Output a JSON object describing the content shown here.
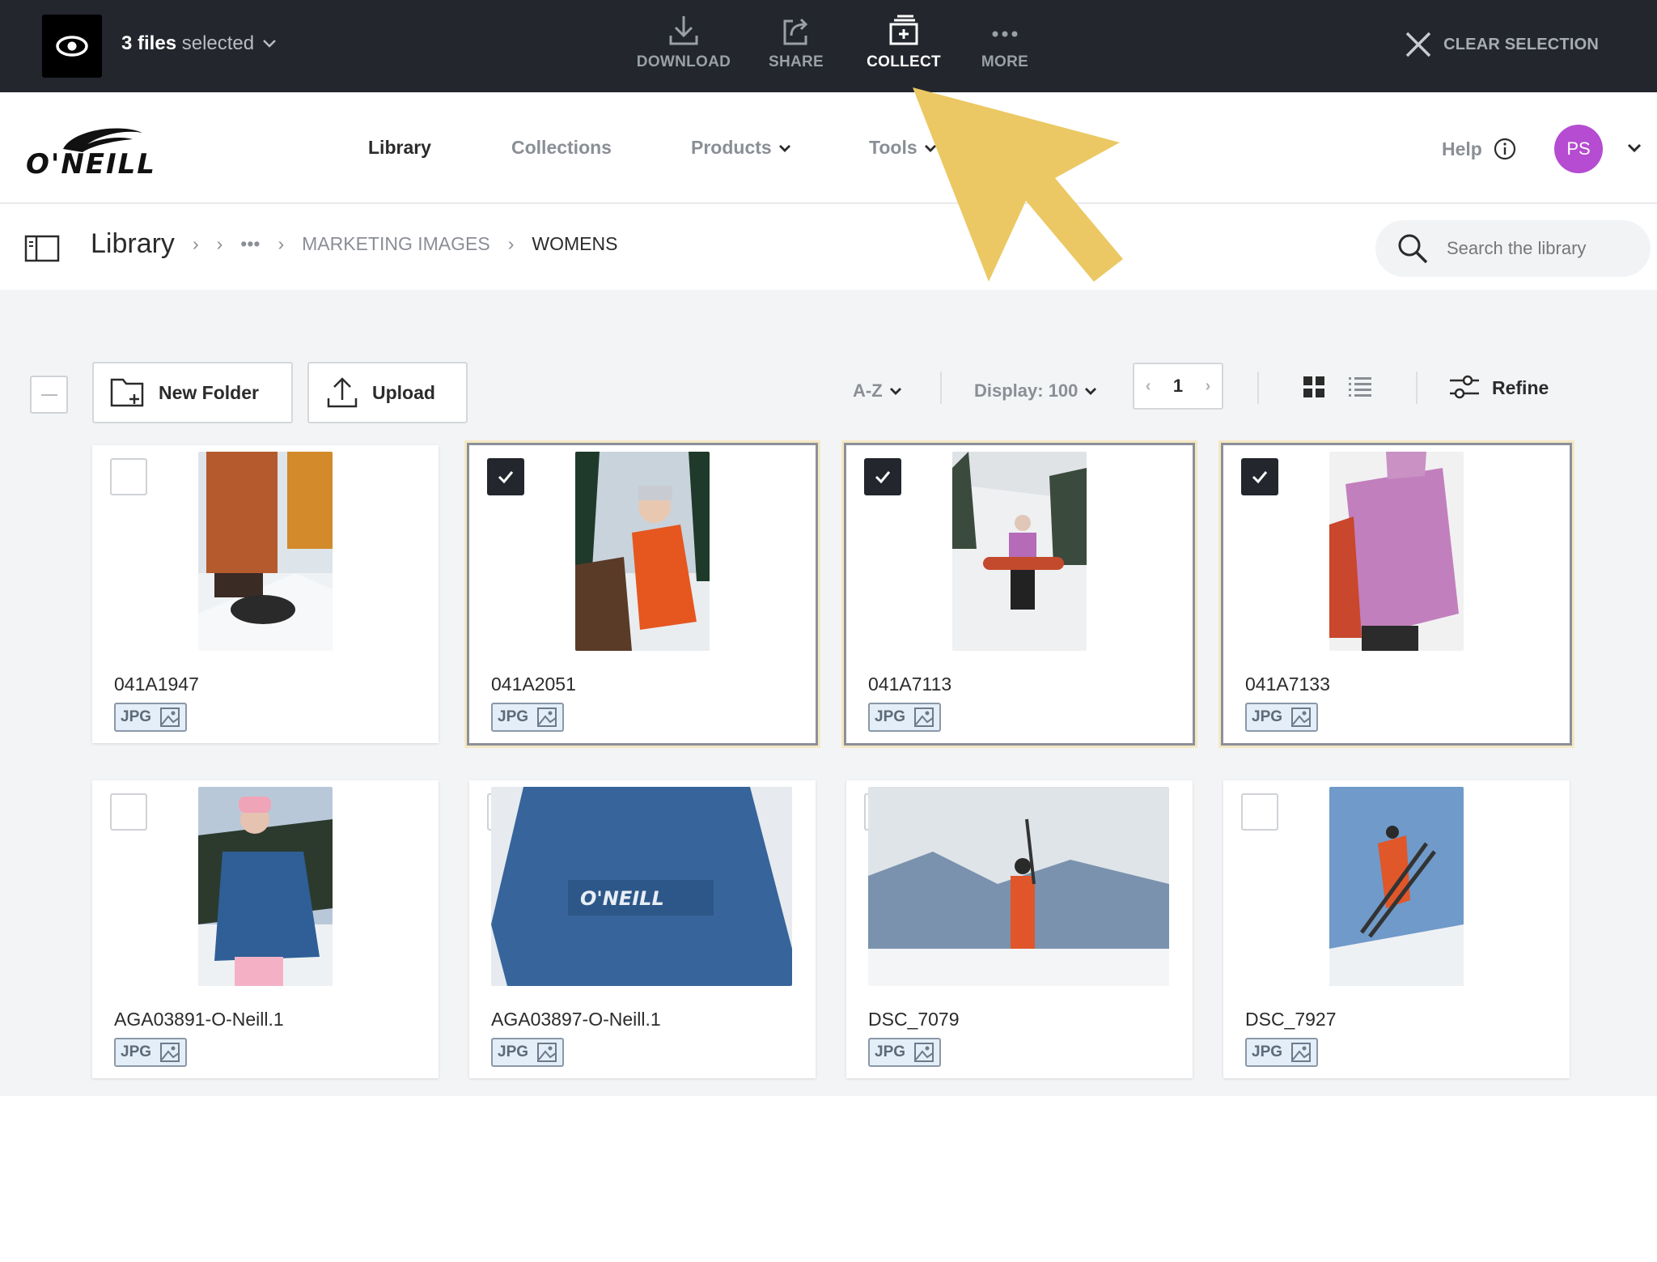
{
  "selection_bar": {
    "count_strong": "3 files",
    "count_rest": "selected",
    "actions": [
      {
        "label": "DOWNLOAD",
        "icon": "download-icon"
      },
      {
        "label": "SHARE",
        "icon": "share-icon"
      },
      {
        "label": "COLLECT",
        "icon": "collect-icon"
      },
      {
        "label": "MORE",
        "icon": "more-icon"
      }
    ],
    "clear_label": "CLEAR SELECTION"
  },
  "nav": {
    "logo_text": "O'NEILL",
    "items": [
      {
        "label": "Library",
        "active": true
      },
      {
        "label": "Collections"
      },
      {
        "label": "Products"
      },
      {
        "label": "Tools"
      }
    ],
    "help_label": "Help",
    "avatar_initials": "PS",
    "avatar_color": "#b54cd1"
  },
  "breadcrumb": {
    "root": "Library",
    "ellipsis": "•••",
    "items": [
      "MARKETING IMAGES",
      "WOMENS"
    ]
  },
  "search": {
    "placeholder": "Search the library"
  },
  "toolbar": {
    "new_folder": "New Folder",
    "upload": "Upload",
    "sort": "A-Z",
    "display": "Display: 100",
    "page": "1",
    "refine": "Refine"
  },
  "files": [
    {
      "name": "041A1947",
      "type": "JPG",
      "selected": false
    },
    {
      "name": "041A2051",
      "type": "JPG",
      "selected": true
    },
    {
      "name": "041A7113",
      "type": "JPG",
      "selected": true
    },
    {
      "name": "041A7133",
      "type": "JPG",
      "selected": true
    },
    {
      "name": "AGA03891-O-Neill.1",
      "type": "JPG",
      "selected": false
    },
    {
      "name": "AGA03897-O-Neill.1",
      "type": "JPG",
      "selected": false
    },
    {
      "name": "DSC_7079",
      "type": "JPG",
      "selected": false
    },
    {
      "name": "DSC_7927",
      "type": "JPG",
      "selected": false
    }
  ],
  "colors": {
    "dark_bar": "#23262d",
    "selected_glow": "#f4e8c4",
    "annotation_arrow": "#ebc863"
  }
}
